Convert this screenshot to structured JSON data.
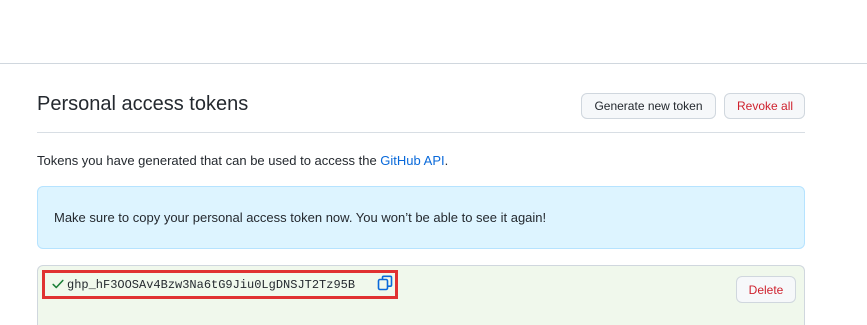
{
  "header": {
    "title": "Personal access tokens",
    "generate_label": "Generate new token",
    "revoke_label": "Revoke all"
  },
  "description": {
    "text": "Tokens you have generated that can be used to access the ",
    "link_text": "GitHub API",
    "suffix": "."
  },
  "flash": {
    "message": "Make sure to copy your personal access token now. You won’t be able to see it again!"
  },
  "token": {
    "value": "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",
    "delete_label": "Delete",
    "check_icon": "check-icon",
    "copy_icon": "copy-icon"
  },
  "colors": {
    "accent_link": "#0969da",
    "danger": "#cf222e",
    "flash_bg": "#ddf4ff",
    "token_bg": "#f0f8ec",
    "highlight": "#e03131",
    "success": "#1a7f37"
  }
}
